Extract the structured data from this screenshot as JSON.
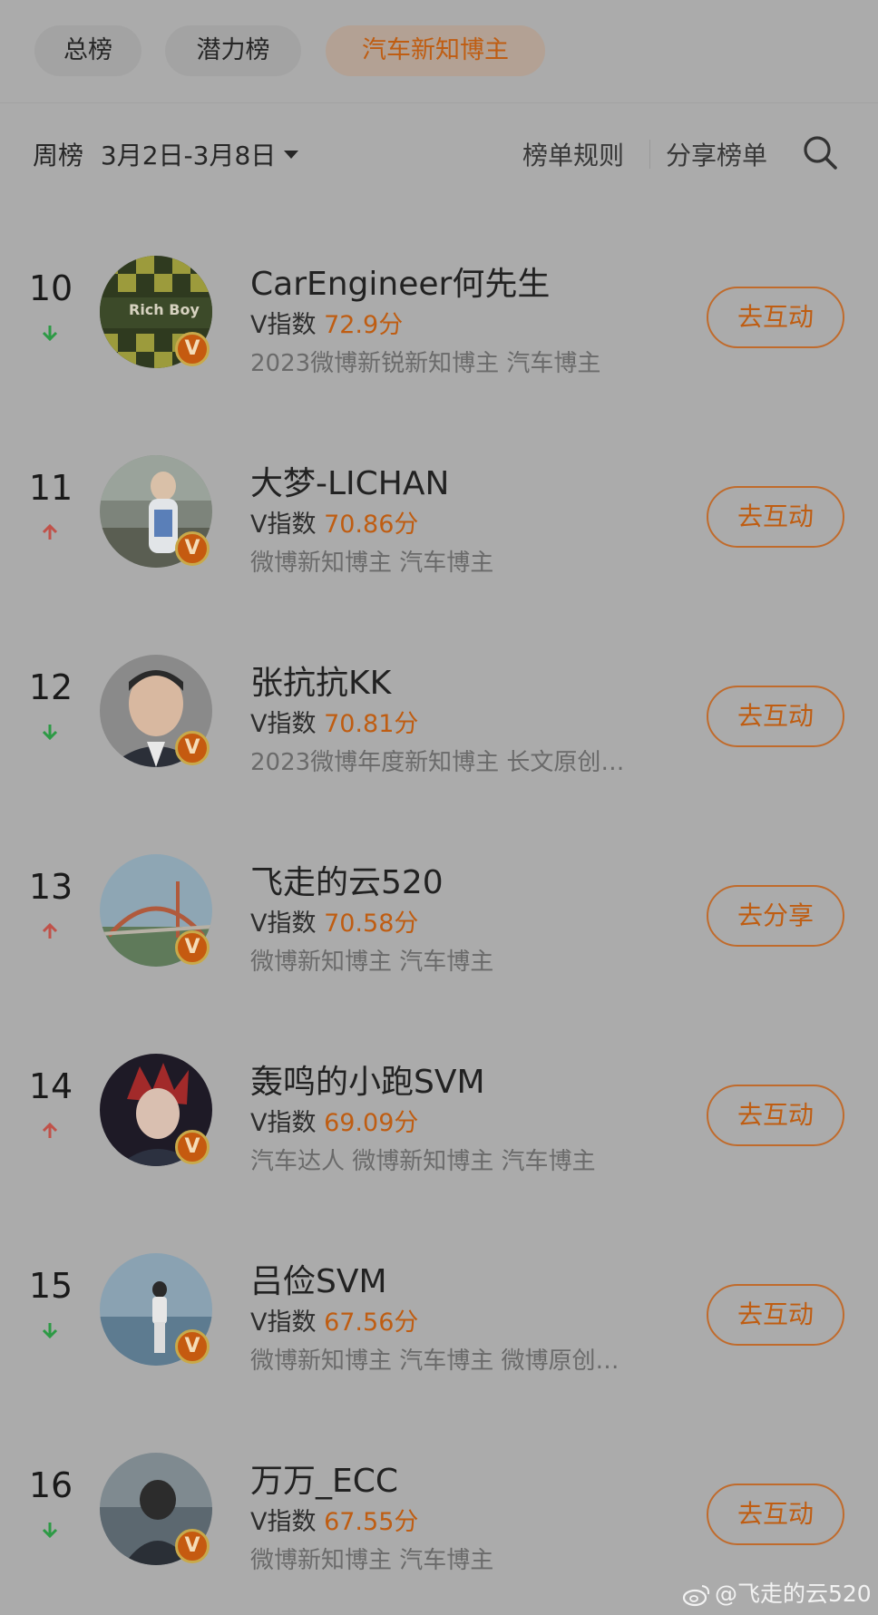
{
  "tabs": [
    {
      "label": "总榜",
      "active": false
    },
    {
      "label": "潜力榜",
      "active": false
    },
    {
      "label": "汽车新知博主",
      "active": true
    }
  ],
  "toolbar": {
    "period_label": "周榜",
    "date_range": "3月2日-3月8日",
    "rules_label": "榜单规则",
    "share_label": "分享榜单"
  },
  "entries": [
    {
      "rank": "10",
      "trend": "down",
      "name": "CarEngineer何先生",
      "score_label": "V指数",
      "score": "72.9分",
      "tags": "2023微博新锐新知博主 汽车博主",
      "action": "去互动"
    },
    {
      "rank": "11",
      "trend": "up",
      "name": "大梦-LICHAN",
      "score_label": "V指数",
      "score": "70.86分",
      "tags": "微博新知博主 汽车博主",
      "action": "去互动"
    },
    {
      "rank": "12",
      "trend": "down",
      "name": "张抗抗KK",
      "score_label": "V指数",
      "score": "70.81分",
      "tags": "2023微博年度新知博主 长文原创…",
      "action": "去互动"
    },
    {
      "rank": "13",
      "trend": "up",
      "name": "飞走的云520",
      "score_label": "V指数",
      "score": "70.58分",
      "tags": "微博新知博主 汽车博主",
      "action": "去分享"
    },
    {
      "rank": "14",
      "trend": "up",
      "name": "轰鸣的小跑SVM",
      "score_label": "V指数",
      "score": "69.09分",
      "tags": "汽车达人 微博新知博主 汽车博主",
      "action": "去互动"
    },
    {
      "rank": "15",
      "trend": "down",
      "name": "吕俭SVM",
      "score_label": "V指数",
      "score": "67.56分",
      "tags": "微博新知博主 汽车博主 微博原创…",
      "action": "去互动"
    },
    {
      "rank": "16",
      "trend": "down",
      "name": "万万_ECC",
      "score_label": "V指数",
      "score": "67.55分",
      "tags": "微博新知博主 汽车博主",
      "action": "去互动"
    }
  ],
  "badge": {
    "letter": "V",
    "color": "#c55a10"
  },
  "colors": {
    "accent": "#bf5d12",
    "trend_up": "#c0524a",
    "trend_down": "#2d9a45"
  },
  "avatar_logo_text": "Rich Boy",
  "watermark": "@飞走的云520"
}
